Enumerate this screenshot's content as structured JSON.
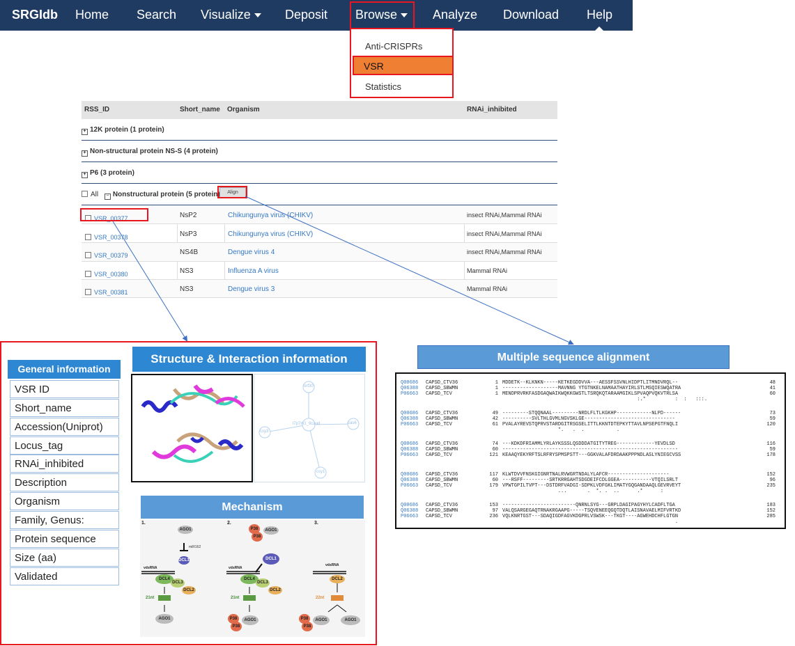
{
  "navbar": {
    "brand": "SRGIdb",
    "items": [
      "Home",
      "Search",
      "Visualize",
      "Deposit",
      "Browse",
      "Analyze",
      "Download",
      "Help"
    ]
  },
  "dropdown": {
    "items": [
      "Anti-CRISPRs",
      "VSR",
      "Statistics"
    ],
    "active": "VSR"
  },
  "table": {
    "headers": [
      "RSS_ID",
      "Short_name",
      "Organism",
      "RNAi_inhibited"
    ],
    "groups": [
      "12K protein (1 protein)",
      "Non-structural protein NS-S (4 protein)",
      "P6 (3 protein)"
    ],
    "open_group": {
      "all_label": "All",
      "name": "Nonstructural protein (5 protein)",
      "align_label": "Align"
    },
    "rows": [
      {
        "id": "VSR_00377",
        "short": "NsP2",
        "organism": "Chikungunya virus (CHIKV)",
        "rnai": "insect RNAi,Mammal RNAi"
      },
      {
        "id": "VSR_00378",
        "short": "NsP3",
        "organism": "Chikungunya virus (CHIKV)",
        "rnai": "insect RNAi,Mammal RNAi"
      },
      {
        "id": "VSR_00379",
        "short": "NS4B",
        "organism": "Dengue virus 4",
        "rnai": "insect RNAi,Mammal RNAi"
      },
      {
        "id": "VSR_00380",
        "short": "NS3",
        "organism": "Influenza A virus",
        "rnai": "Mammal RNAi"
      },
      {
        "id": "VSR_00381",
        "short": "NS3",
        "organism": "Dengue virus 3",
        "rnai": "Mammal RNAi"
      }
    ]
  },
  "general_info": {
    "title": "General information",
    "fields": [
      "VSR ID",
      "Short_name",
      "Accession(Uniprot)",
      "Locus_tag",
      "RNAi_inhibited",
      "Description",
      "Organism",
      "Family, Genus:",
      "Protein sequence",
      "Size (aa)",
      "Validated"
    ]
  },
  "structure": {
    "title": "Structure & Interaction information",
    "nodes": [
      "orf30",
      "cas6",
      "csy1",
      "csy3",
      "l7p7m1_9caud"
    ]
  },
  "mechanism": {
    "title": "Mechanism",
    "panels": [
      "1.",
      "2.",
      "3."
    ],
    "labels": {
      "ago1": "AGO1",
      "dcl1": "DCL1",
      "dcl4": "DCL4",
      "dcl3": "DCL3",
      "dcl2": "DCL2",
      "p38": "P38",
      "mir162": "miR162",
      "vdsrna": "vdsRNA",
      "nt21": "21nt",
      "nt22": "22nt"
    }
  },
  "alignment": {
    "title": "Multiple sequence alignment",
    "blocks": [
      {
        "rows": [
          {
            "acc": "Q00686",
            "name": "CAPSD_CTV36",
            "start": "1",
            "seq": "MDDETK--KLKNKN-----KETKEGDDVVA---AESSFSSVNLHIDPTLITMNDVRQL--",
            "end": "48"
          },
          {
            "acc": "Q06388",
            "name": "CAPSD_SBWMN",
            "start": "1",
            "seq": "-------------------MAVNNG YTGTNKELNAMAATHAYIRLSTLMSQIESWQATRA",
            "end": "41"
          },
          {
            "acc": "P06663",
            "name": "CAPSD_TCV",
            "start": "1",
            "seq": "MENDPRVRKFASDGAQWAIKWQKKGWSTLTSRQKQTARAAMGIKLSPVAQPVQKVTRLSA",
            "end": "60"
          }
        ],
        "cons": "                                              :.*          :  :   :::."
      },
      {
        "rows": [
          {
            "acc": "Q00686",
            "name": "CAPSD_CTV36",
            "start": "49",
            "seq": "---------STQQNAAL---------NRDLFLTLKGKHP------------NLPD------",
            "end": "73"
          },
          {
            "acc": "Q06388",
            "name": "CAPSD_SBWMN",
            "start": "42",
            "seq": "----------SVLTHLGVMLNGVSKLGE-------------------------------",
            "end": "59"
          },
          {
            "acc": "P06663",
            "name": "CAPSD_TCV",
            "start": "61",
            "seq": "PVALAYREVSTQPRVSTARDGITRSGSELITTLKKNTDTEPKYTTAVLNPSEPGTFNQLI",
            "end": "120"
          }
        ],
        "cons": "                   *.   .  .           ."
      },
      {
        "rows": [
          {
            "acc": "Q00686",
            "name": "CAPSD_CTV36",
            "start": "74",
            "seq": "---KDKDFRIAMMLYRLAYKSSSLQSDDDATGITYTREG-------------YEVDLSD",
            "end": "116"
          },
          {
            "acc": "Q06388",
            "name": "CAPSD_SBWMN",
            "start": "60",
            "seq": "------------------------------------------------------------",
            "end": "59"
          },
          {
            "acc": "P06663",
            "name": "CAPSD_TCV",
            "start": "121",
            "seq": "KEAAQYEKYRFTSLRFRYSPMSPSTT---GGKVALAFDRDAAKPPPNDLASLYNIEGCVSS",
            "end": "178"
          }
        ],
        "cons": ""
      },
      {
        "rows": [
          {
            "acc": "Q00686",
            "name": "CAPSD_CTV36",
            "start": "117",
            "seq": "KLWTDVVFNSKGIGNRTNALRVWGRTNDALYLAFCR---------------------",
            "end": "152"
          },
          {
            "acc": "Q06388",
            "name": "CAPSD_SBWMN",
            "start": "60",
            "seq": "---RSFF---------SRTKRRGAHTSDGDEIFCDLGGEA-----------VTQILSRLT",
            "end": "96"
          },
          {
            "acc": "P06663",
            "name": "CAPSD_TCV",
            "start": "179",
            "seq": "VPWTGPILTVPT---DSTDRFVADGI-SDPKLVDFGKLIMATYGQGANDAAQLGEVRVEYT",
            "end": "235"
          }
        ],
        "cons": "                   ...       .  *. .  ..      .*      :"
      },
      {
        "rows": [
          {
            "acc": "Q00686",
            "name": "CAPSD_CTV36",
            "start": "153",
            "seq": "-------------------------QNRNLSYG---GRPLDAGIPAGYHYLCADFLTGA",
            "end": "183"
          },
          {
            "acc": "Q06388",
            "name": "CAPSD_SBWMN",
            "start": "97",
            "seq": "VALQSARGEGAQTRNAKRGAAPG-----TSQVENEEQGQTDQTLAISNAVAELMIFVRTKD",
            "end": "152"
          },
          {
            "acc": "P06663",
            "name": "CAPSD_TCV",
            "start": "236",
            "seq": "VQLKNRTGST---SDAQIGDFAGVKDGPRLVSWSK---TKGT----AGWEHDCHFLGTGN",
            "end": "285"
          }
        ],
        "cons": "                                                           ."
      }
    ]
  }
}
